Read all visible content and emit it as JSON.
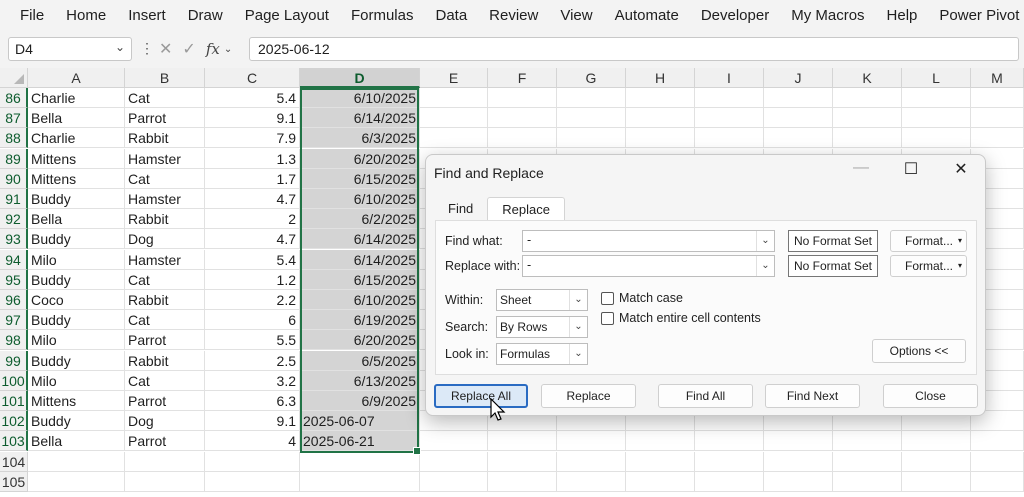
{
  "menu": [
    "File",
    "Home",
    "Insert",
    "Draw",
    "Page Layout",
    "Formulas",
    "Data",
    "Review",
    "View",
    "Automate",
    "Developer",
    "My Macros",
    "Help",
    "Power Pivot"
  ],
  "formula_bar": {
    "name_box": "D4",
    "content": "2025-06-12"
  },
  "columns": [
    "A",
    "B",
    "C",
    "D",
    "E",
    "F",
    "G",
    "H",
    "I",
    "J",
    "K",
    "L",
    "M"
  ],
  "selected_column": "D",
  "rows": [
    {
      "n": "86",
      "a": "Charlie",
      "b": "Cat",
      "c": "5.4",
      "d": "6/10/2025",
      "d_num": true
    },
    {
      "n": "87",
      "a": "Bella",
      "b": "Parrot",
      "c": "9.1",
      "d": "6/14/2025",
      "d_num": true
    },
    {
      "n": "88",
      "a": "Charlie",
      "b": "Rabbit",
      "c": "7.9",
      "d": "6/3/2025",
      "d_num": true
    },
    {
      "n": "89",
      "a": "Mittens",
      "b": "Hamster",
      "c": "1.3",
      "d": "6/20/2025",
      "d_num": true
    },
    {
      "n": "90",
      "a": "Mittens",
      "b": "Cat",
      "c": "1.7",
      "d": "6/15/2025",
      "d_num": true
    },
    {
      "n": "91",
      "a": "Buddy",
      "b": "Hamster",
      "c": "4.7",
      "d": "6/10/2025",
      "d_num": true
    },
    {
      "n": "92",
      "a": "Bella",
      "b": "Rabbit",
      "c": "2",
      "d": "6/2/2025",
      "d_num": true
    },
    {
      "n": "93",
      "a": "Buddy",
      "b": "Dog",
      "c": "4.7",
      "d": "6/14/2025",
      "d_num": true
    },
    {
      "n": "94",
      "a": "Milo",
      "b": "Hamster",
      "c": "5.4",
      "d": "6/14/2025",
      "d_num": true
    },
    {
      "n": "95",
      "a": "Buddy",
      "b": "Cat",
      "c": "1.2",
      "d": "6/15/2025",
      "d_num": true
    },
    {
      "n": "96",
      "a": "Coco",
      "b": "Rabbit",
      "c": "2.2",
      "d": "6/10/2025",
      "d_num": true
    },
    {
      "n": "97",
      "a": "Buddy",
      "b": "Cat",
      "c": "6",
      "d": "6/19/2025",
      "d_num": true
    },
    {
      "n": "98",
      "a": "Milo",
      "b": "Parrot",
      "c": "5.5",
      "d": "6/20/2025",
      "d_num": true
    },
    {
      "n": "99",
      "a": "Buddy",
      "b": "Rabbit",
      "c": "2.5",
      "d": "6/5/2025",
      "d_num": true
    },
    {
      "n": "100",
      "a": "Milo",
      "b": "Cat",
      "c": "3.2",
      "d": "6/13/2025",
      "d_num": true
    },
    {
      "n": "101",
      "a": "Mittens",
      "b": "Parrot",
      "c": "6.3",
      "d": "6/9/2025",
      "d_num": true
    },
    {
      "n": "102",
      "a": "Buddy",
      "b": "Dog",
      "c": "9.1",
      "d": "2025-06-07",
      "d_num": false
    },
    {
      "n": "103",
      "a": "Bella",
      "b": "Parrot",
      "c": "4",
      "d": "2025-06-21",
      "d_num": false
    },
    {
      "n": "104",
      "a": "",
      "b": "",
      "c": "",
      "d": "",
      "d_num": false
    },
    {
      "n": "105",
      "a": "",
      "b": "",
      "c": "",
      "d": "",
      "d_num": false
    }
  ],
  "dialog": {
    "title": "Find and Replace",
    "minimize": "—",
    "maximize": "☐",
    "close": "✕",
    "tabs": [
      "Find",
      "Replace"
    ],
    "active_tab": "Replace",
    "find_what_label": "Find what:",
    "find_what_value": "-",
    "replace_with_label": "Replace with:",
    "replace_with_value": "-",
    "no_format_set": "No Format Set",
    "format_button": "Format...",
    "within_label": "Within:",
    "within_value": "Sheet",
    "search_label": "Search:",
    "search_value": "By Rows",
    "look_in_label": "Look in:",
    "look_in_value": "Formulas",
    "match_case_label": "Match case",
    "match_case_checked": false,
    "match_entire_label": "Match entire cell contents",
    "match_entire_checked": false,
    "options_button": "Options <<",
    "buttons": {
      "replace_all": "Replace All",
      "replace": "Replace",
      "find_all": "Find All",
      "find_next": "Find Next",
      "close": "Close"
    }
  },
  "colors": {
    "accent_green": "#217346",
    "selection_gray": "#d4d4d4",
    "primary_button_border": "#2a6bc2"
  }
}
